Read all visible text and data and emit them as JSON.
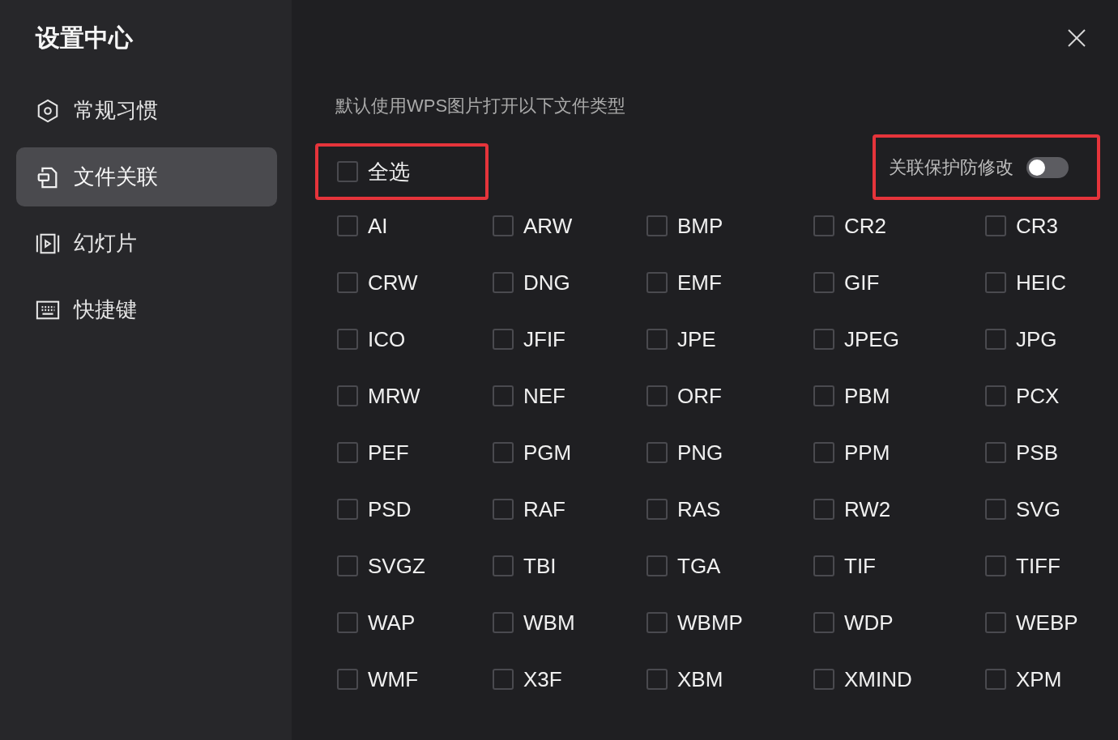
{
  "window": {
    "title": "设置中心"
  },
  "sidebar": {
    "items": [
      {
        "label": "常规习惯",
        "selected": false
      },
      {
        "label": "文件关联",
        "selected": true
      },
      {
        "label": "幻灯片",
        "selected": false
      },
      {
        "label": "快捷键",
        "selected": false
      }
    ]
  },
  "file_types": {
    "heading": "默认使用WPS图片打开以下文件类型",
    "select_all": {
      "label": "全选",
      "checked": false,
      "highlighted": true
    },
    "protection": {
      "label": "关联保护防修改",
      "on": false,
      "highlighted": true
    },
    "items": [
      {
        "label": "AI",
        "checked": false
      },
      {
        "label": "ARW",
        "checked": false
      },
      {
        "label": "BMP",
        "checked": false
      },
      {
        "label": "CR2",
        "checked": false
      },
      {
        "label": "CR3",
        "checked": false
      },
      {
        "label": "CRW",
        "checked": false
      },
      {
        "label": "DNG",
        "checked": false
      },
      {
        "label": "EMF",
        "checked": false
      },
      {
        "label": "GIF",
        "checked": false
      },
      {
        "label": "HEIC",
        "checked": false
      },
      {
        "label": "ICO",
        "checked": false
      },
      {
        "label": "JFIF",
        "checked": false
      },
      {
        "label": "JPE",
        "checked": false
      },
      {
        "label": "JPEG",
        "checked": false
      },
      {
        "label": "JPG",
        "checked": false
      },
      {
        "label": "MRW",
        "checked": false
      },
      {
        "label": "NEF",
        "checked": false
      },
      {
        "label": "ORF",
        "checked": false
      },
      {
        "label": "PBM",
        "checked": false
      },
      {
        "label": "PCX",
        "checked": false
      },
      {
        "label": "PEF",
        "checked": false
      },
      {
        "label": "PGM",
        "checked": false
      },
      {
        "label": "PNG",
        "checked": false
      },
      {
        "label": "PPM",
        "checked": false
      },
      {
        "label": "PSB",
        "checked": false
      },
      {
        "label": "PSD",
        "checked": false
      },
      {
        "label": "RAF",
        "checked": false
      },
      {
        "label": "RAS",
        "checked": false
      },
      {
        "label": "RW2",
        "checked": false
      },
      {
        "label": "SVG",
        "checked": false
      },
      {
        "label": "SVGZ",
        "checked": false
      },
      {
        "label": "TBI",
        "checked": false
      },
      {
        "label": "TGA",
        "checked": false
      },
      {
        "label": "TIF",
        "checked": false
      },
      {
        "label": "TIFF",
        "checked": false
      },
      {
        "label": "WAP",
        "checked": false
      },
      {
        "label": "WBM",
        "checked": false
      },
      {
        "label": "WBMP",
        "checked": false
      },
      {
        "label": "WDP",
        "checked": false
      },
      {
        "label": "WEBP",
        "checked": false
      },
      {
        "label": "WMF",
        "checked": false
      },
      {
        "label": "X3F",
        "checked": false
      },
      {
        "label": "XBM",
        "checked": false
      },
      {
        "label": "XMIND",
        "checked": false
      },
      {
        "label": "XPM",
        "checked": false
      }
    ]
  }
}
